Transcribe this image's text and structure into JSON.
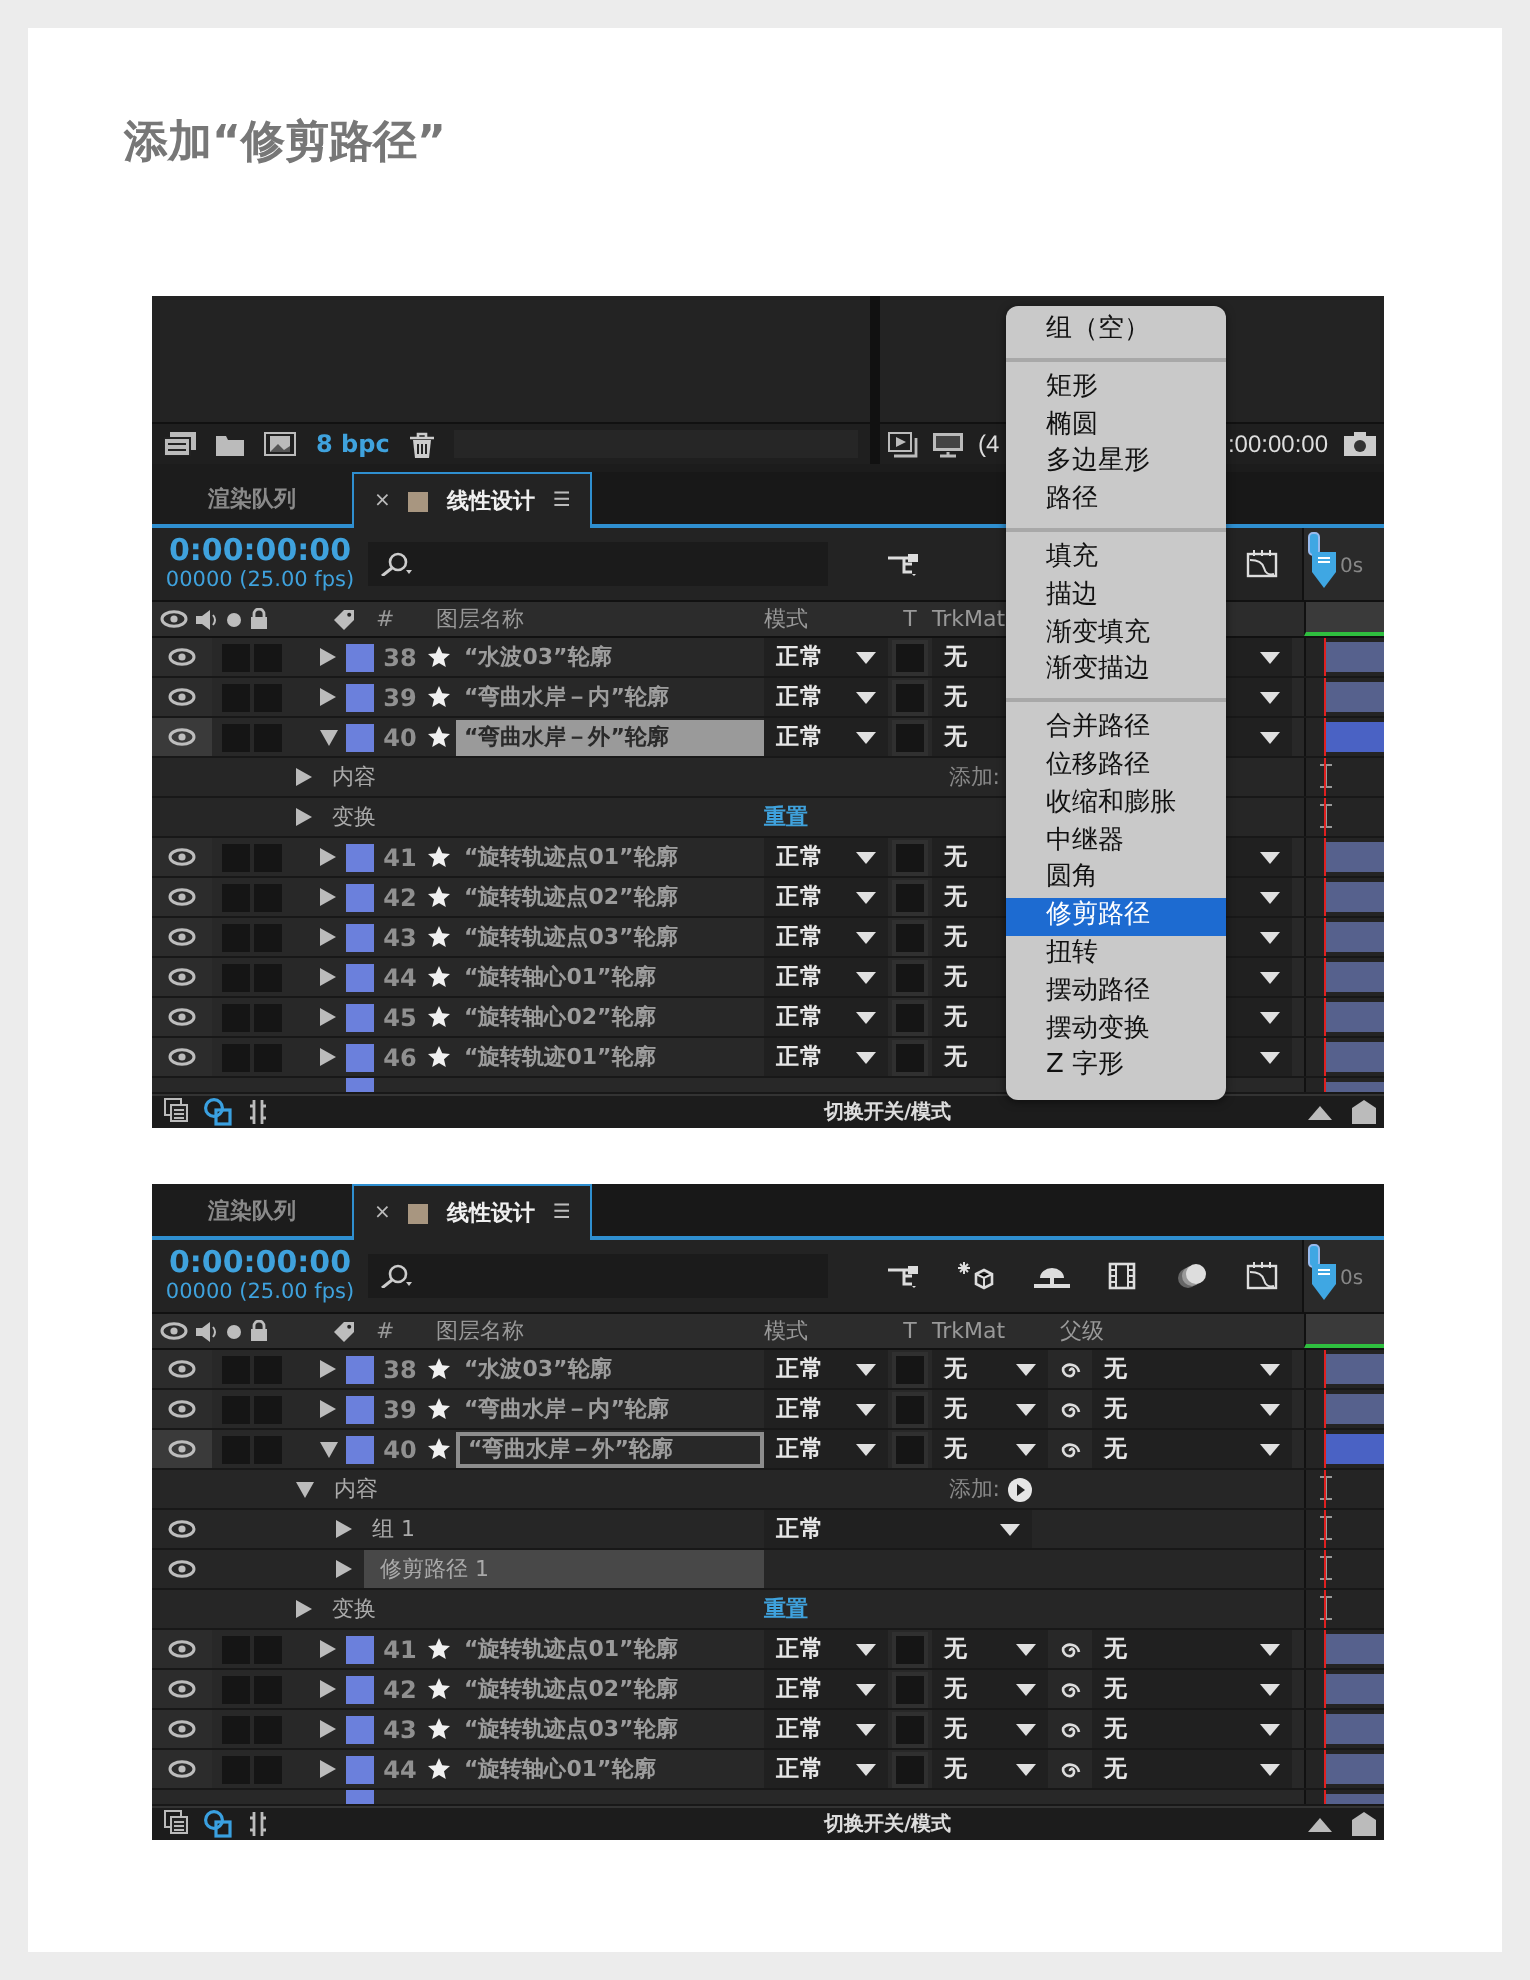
{
  "heading": "添加“修剪路径”",
  "screenshots": [
    {
      "project_bar": {
        "bpc": "8 bpc"
      },
      "viewer_bar": {
        "zoom": "(4",
        "timecode": ":00:00:00"
      },
      "tabs": [
        {
          "label": "渲染队列",
          "selected": false
        },
        {
          "label": "线性设计",
          "selected": true,
          "close": "×",
          "menu": "☰"
        }
      ],
      "timecode": "0:00:00:00",
      "frame_info": "00000 (25.00 fps)",
      "ruler_label": "0s",
      "columns": {
        "number": "#",
        "name": "图层名称",
        "mode": "模式",
        "track": "T",
        "trkmat": "TrkMat"
      },
      "rows": [
        {
          "kind": "layer",
          "number": "38",
          "name": "“水波03”轮廓",
          "mode": "正常",
          "trkmat": "无",
          "preserve_transparency": false,
          "expanded": false,
          "selected": false,
          "name_highlighted": false
        },
        {
          "kind": "layer",
          "number": "39",
          "name": "“弯曲水岸－内”轮廓",
          "mode": "正常",
          "trkmat": "无",
          "preserve_transparency": false,
          "expanded": false,
          "selected": false,
          "name_highlighted": false
        },
        {
          "kind": "layer",
          "number": "40",
          "name": "“弯曲水岸－外”轮廓",
          "mode": "正常",
          "trkmat": "无",
          "preserve_transparency": false,
          "expanded": true,
          "selected": true,
          "name_highlighted": true,
          "children": [
            {
              "kind": "group",
              "label": "内容",
              "expanded": false,
              "add_label": "添加:"
            },
            {
              "kind": "group",
              "label": "变换",
              "expanded": false,
              "reset_label": "重置"
            }
          ]
        },
        {
          "kind": "layer",
          "number": "41",
          "name": "“旋转轨迹点01”轮廓",
          "mode": "正常",
          "trkmat": "无",
          "preserve_transparency": false,
          "expanded": false,
          "selected": false,
          "name_highlighted": false
        },
        {
          "kind": "layer",
          "number": "42",
          "name": "“旋转轨迹点02”轮廓",
          "mode": "正常",
          "trkmat": "无",
          "preserve_transparency": false,
          "expanded": false,
          "selected": false,
          "name_highlighted": false
        },
        {
          "kind": "layer",
          "number": "43",
          "name": "“旋转轨迹点03”轮廓",
          "mode": "正常",
          "trkmat": "无",
          "preserve_transparency": false,
          "expanded": false,
          "selected": false,
          "name_highlighted": false
        },
        {
          "kind": "layer",
          "number": "44",
          "name": "“旋转轴心01”轮廓",
          "mode": "正常",
          "trkmat": "无",
          "preserve_transparency": false,
          "expanded": false,
          "selected": false,
          "name_highlighted": false
        },
        {
          "kind": "layer",
          "number": "45",
          "name": "“旋转轴心02”轮廓",
          "mode": "正常",
          "trkmat": "无",
          "preserve_transparency": false,
          "expanded": false,
          "selected": false,
          "name_highlighted": false
        },
        {
          "kind": "layer",
          "number": "46",
          "name": "“旋转轨迹01”轮廓",
          "mode": "正常",
          "trkmat": "无",
          "preserve_transparency": false,
          "expanded": false,
          "selected": false,
          "name_highlighted": false
        }
      ],
      "more_rows_below": true,
      "footer": "切换开关/模式",
      "menu": {
        "sections": [
          {
            "items": [
              {
                "label": "组（空）",
                "selected": false
              }
            ]
          },
          {
            "items": [
              {
                "label": "矩形",
                "selected": false
              },
              {
                "label": "椭圆",
                "selected": false
              },
              {
                "label": "多边星形",
                "selected": false
              },
              {
                "label": "路径",
                "selected": false
              }
            ]
          },
          {
            "items": [
              {
                "label": "填充",
                "selected": false
              },
              {
                "label": "描边",
                "selected": false
              },
              {
                "label": "渐变填充",
                "selected": false
              },
              {
                "label": "渐变描边",
                "selected": false
              }
            ]
          },
          {
            "items": [
              {
                "label": "合并路径",
                "selected": false
              },
              {
                "label": "位移路径",
                "selected": false
              },
              {
                "label": "收缩和膨胀",
                "selected": false
              },
              {
                "label": "中继器",
                "selected": false
              },
              {
                "label": "圆角",
                "selected": false
              },
              {
                "label": "修剪路径",
                "selected": true
              },
              {
                "label": "扭转",
                "selected": false
              },
              {
                "label": "摆动路径",
                "selected": false
              },
              {
                "label": "摆动变换",
                "selected": false
              },
              {
                "label": "Z 字形",
                "selected": false
              }
            ]
          }
        ]
      }
    },
    {
      "tabs": [
        {
          "label": "渲染队列",
          "selected": false
        },
        {
          "label": "线性设计",
          "selected": true,
          "close": "×",
          "menu": "☰"
        }
      ],
      "timecode": "0:00:00:00",
      "frame_info": "00000 (25.00 fps)",
      "ruler_label": "0s",
      "columns": {
        "number": "#",
        "name": "图层名称",
        "mode": "模式",
        "track": "T",
        "trkmat": "TrkMat",
        "parent": "父级"
      },
      "rows": [
        {
          "kind": "layer",
          "number": "38",
          "name": "“水波03”轮廓",
          "mode": "正常",
          "trkmat": "无",
          "parent": "无",
          "preserve_transparency": false,
          "expanded": false,
          "selected": false,
          "name_outlined": false
        },
        {
          "kind": "layer",
          "number": "39",
          "name": "“弯曲水岸－内”轮廓",
          "mode": "正常",
          "trkmat": "无",
          "parent": "无",
          "preserve_transparency": false,
          "expanded": false,
          "selected": false,
          "name_outlined": false
        },
        {
          "kind": "layer",
          "number": "40",
          "name": "“弯曲水岸－外”轮廓",
          "mode": "正常",
          "trkmat": "无",
          "parent": "无",
          "preserve_transparency": false,
          "expanded": true,
          "selected": true,
          "name_outlined": true,
          "children": [
            {
              "kind": "group",
              "label": "内容",
              "expanded": true,
              "add_label": "添加:",
              "children": [
                {
                  "kind": "shape",
                  "label": "组 1",
                  "mode": "正常",
                  "expanded": false,
                  "selected": false
                },
                {
                  "kind": "shape",
                  "label": "修剪路径 1",
                  "expanded": false,
                  "selected": true
                }
              ]
            },
            {
              "kind": "group",
              "label": "变换",
              "expanded": false,
              "reset_label": "重置"
            }
          ]
        },
        {
          "kind": "layer",
          "number": "41",
          "name": "“旋转轨迹点01”轮廓",
          "mode": "正常",
          "trkmat": "无",
          "parent": "无",
          "preserve_transparency": false,
          "expanded": false,
          "selected": false,
          "name_outlined": false
        },
        {
          "kind": "layer",
          "number": "42",
          "name": "“旋转轨迹点02”轮廓",
          "mode": "正常",
          "trkmat": "无",
          "parent": "无",
          "preserve_transparency": false,
          "expanded": false,
          "selected": false,
          "name_outlined": false
        },
        {
          "kind": "layer",
          "number": "43",
          "name": "“旋转轨迹点03”轮廓",
          "mode": "正常",
          "trkmat": "无",
          "parent": "无",
          "preserve_transparency": false,
          "expanded": false,
          "selected": false,
          "name_outlined": false
        },
        {
          "kind": "layer",
          "number": "44",
          "name": "“旋转轴心01”轮廓",
          "mode": "正常",
          "trkmat": "无",
          "parent": "无",
          "preserve_transparency": false,
          "expanded": false,
          "selected": false,
          "name_outlined": false
        }
      ],
      "more_rows_below": true,
      "footer": "切换开关/模式"
    }
  ]
}
